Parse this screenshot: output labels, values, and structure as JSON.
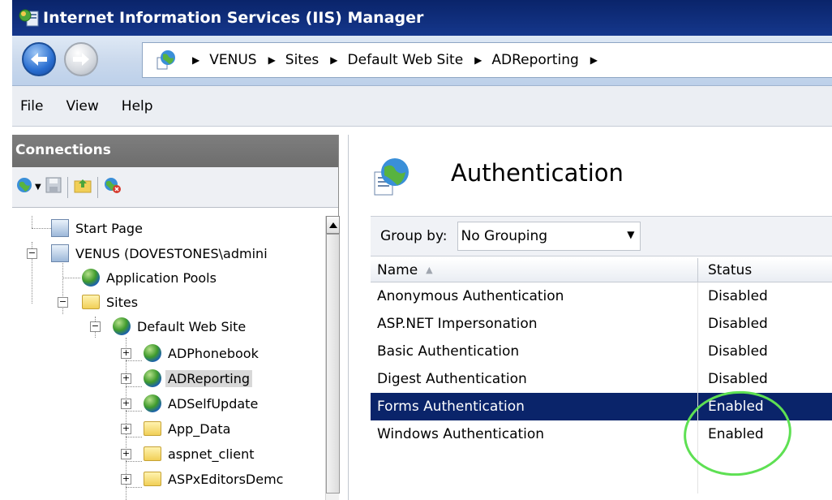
{
  "window": {
    "title": "Internet Information Services (IIS) Manager"
  },
  "address": {
    "crumbs": [
      "VENUS",
      "Sites",
      "Default Web Site",
      "ADReporting"
    ]
  },
  "menu": {
    "file": "File",
    "view": "View",
    "help": "Help"
  },
  "connections": {
    "header": "Connections",
    "tree": [
      {
        "label": "Start Page",
        "icon": "start-page-icon"
      },
      {
        "label": "VENUS (DOVESTONES\\admini",
        "icon": "server-icon"
      },
      {
        "label": "Application Pools",
        "icon": "app-pools-icon"
      },
      {
        "label": "Sites",
        "icon": "sites-folder-icon"
      },
      {
        "label": "Default Web Site",
        "icon": "website-globe-icon"
      },
      {
        "label": "ADPhonebook",
        "icon": "web-app-icon"
      },
      {
        "label": "ADReporting",
        "icon": "web-app-icon",
        "selected": true
      },
      {
        "label": "ADSelfUpdate",
        "icon": "web-app-icon"
      },
      {
        "label": "App_Data",
        "icon": "folder-icon"
      },
      {
        "label": "aspnet_client",
        "icon": "folder-icon"
      },
      {
        "label": "ASPxEditorsDemc",
        "icon": "virtual-dir-icon"
      }
    ]
  },
  "feature": {
    "title": "Authentication",
    "group_by_label": "Group by:",
    "group_by_value": "No Grouping",
    "columns": {
      "name": "Name",
      "status": "Status"
    },
    "rows": [
      {
        "name": "Anonymous Authentication",
        "status": "Disabled"
      },
      {
        "name": "ASP.NET Impersonation",
        "status": "Disabled"
      },
      {
        "name": "Basic Authentication",
        "status": "Disabled"
      },
      {
        "name": "Digest Authentication",
        "status": "Disabled"
      },
      {
        "name": "Forms Authentication",
        "status": "Enabled",
        "selected": true
      },
      {
        "name": "Windows Authentication",
        "status": "Enabled"
      }
    ]
  },
  "colors": {
    "titlebar": "#0a246a",
    "selection": "#0a246a",
    "annotation_circle": "#5ee053"
  }
}
